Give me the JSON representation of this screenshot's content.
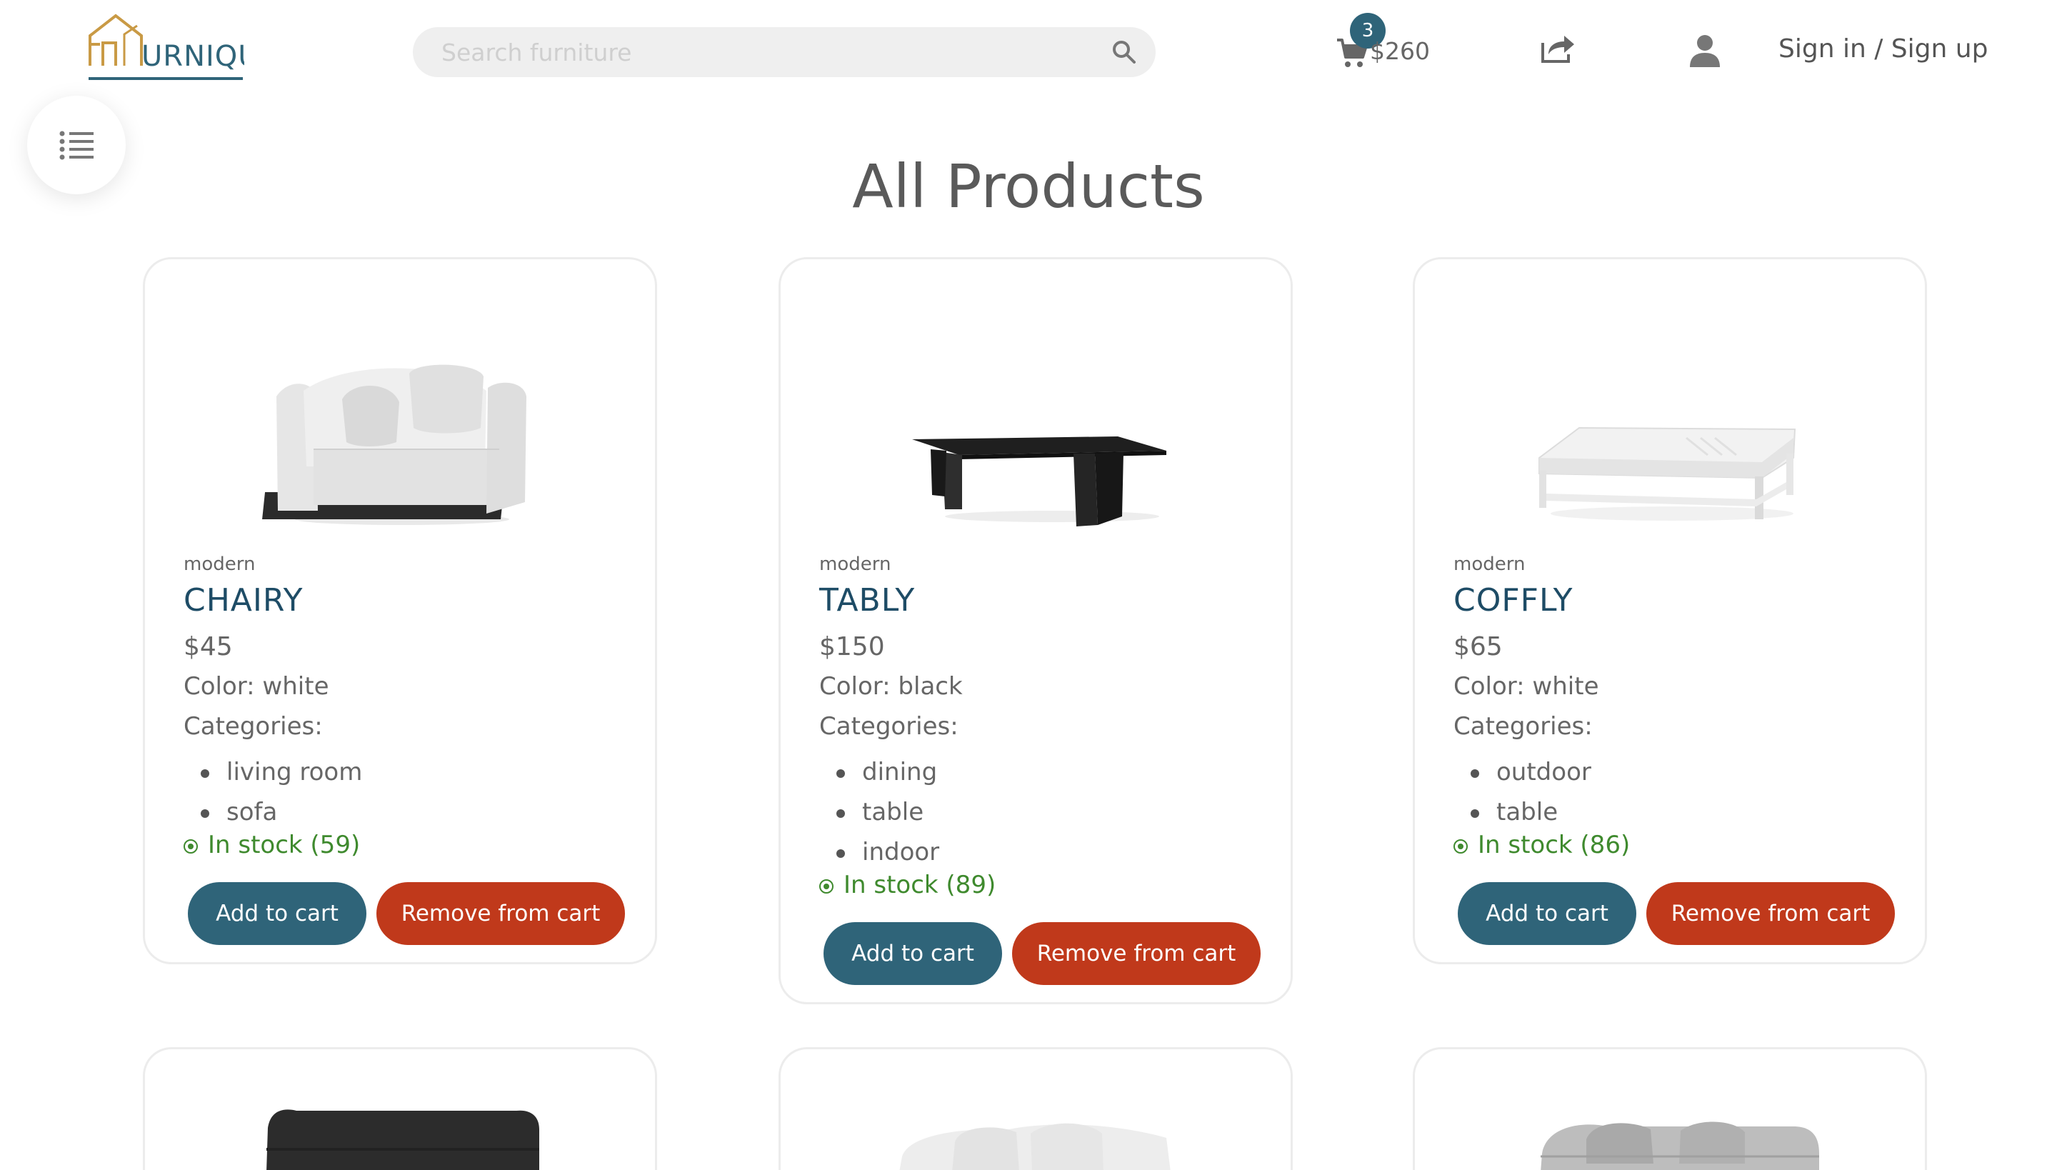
{
  "header": {
    "logo_text": "URNIQUE",
    "search_placeholder": "Search furniture",
    "cart_count": "3",
    "cart_total": "$260",
    "signin_label": "Sign in / Sign up"
  },
  "page_title": "All Products",
  "products": [
    {
      "style": "modern",
      "name": "CHAIRY",
      "price": "$45",
      "color": "Color: white",
      "categories_label": "Categories:",
      "categories": [
        "living room",
        "sofa"
      ],
      "stock": "In stock (59)",
      "add_label": "Add to cart",
      "remove_label": "Remove from cart"
    },
    {
      "style": "modern",
      "name": "TABLY",
      "price": "$150",
      "color": "Color: black",
      "categories_label": "Categories:",
      "categories": [
        "dining",
        "table",
        "indoor"
      ],
      "stock": "In stock (89)",
      "add_label": "Add to cart",
      "remove_label": "Remove from cart"
    },
    {
      "style": "modern",
      "name": "COFFLY",
      "price": "$65",
      "color": "Color: white",
      "categories_label": "Categories:",
      "categories": [
        "outdoor",
        "table"
      ],
      "stock": "In stock (86)",
      "add_label": "Add to cart",
      "remove_label": "Remove from cart"
    }
  ],
  "colors": {
    "accent": "#2f6479",
    "danger": "#c0391b",
    "product_name": "#1e4c66",
    "in_stock": "#3f8a2e",
    "logo_gold": "#c99a45"
  },
  "icons": [
    "search-icon",
    "cart-icon",
    "share-icon",
    "user-icon",
    "list-menu-icon"
  ]
}
